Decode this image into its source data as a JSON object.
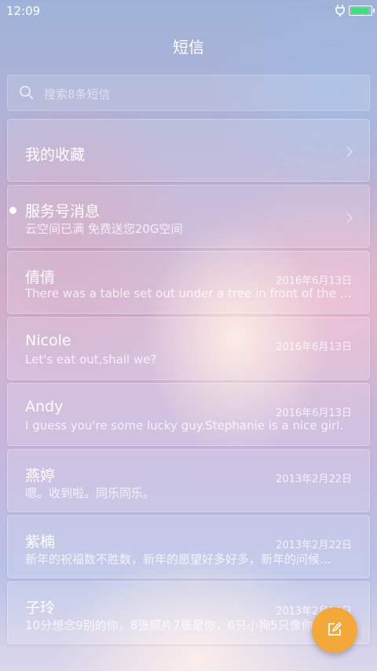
{
  "status_bar": {
    "time": "12:09",
    "battery_level": 0.95
  },
  "header": {
    "title": "短信"
  },
  "search": {
    "placeholder": "搜索8条短信"
  },
  "pinned": [
    {
      "title": "我的收藏",
      "subtitle": "",
      "unread": false
    },
    {
      "title": "服务号消息",
      "subtitle": "云空间已满 免费送您20G空间",
      "unread": true
    }
  ],
  "conversations": [
    {
      "name": "倩倩",
      "date": "2016年6月13日",
      "preview": "There was a table set out under a tree in front of the ho..."
    },
    {
      "name": "Nicole",
      "date": "2016年6月13日",
      "preview": "Let's eat out,shall we?"
    },
    {
      "name": "Andy",
      "date": "2016年6月13日",
      "preview": "I guess you're some lucky guy.Stephanie is a nice girl."
    },
    {
      "name": "燕婷",
      "date": "2013年2月22日",
      "preview": "嗯。收到啦。同乐同乐。"
    },
    {
      "name": "紫楠",
      "date": "2013年2月22日",
      "preview": "新年的祝福数不胜数，新年的愿望好多好多，新年的问候..."
    },
    {
      "name": "子玲",
      "date": "2013年2月22日",
      "preview": "10分想念9别的你，8张照片7张是你，6只小狗5只像你..."
    }
  ],
  "colors": {
    "accent_fab": "#f5a83a",
    "battery_fill": "#3fe07a"
  },
  "icons": {
    "search": "search-icon",
    "chevron": "chevron-right-icon",
    "compose": "compose-icon",
    "plug": "plug-icon",
    "battery": "battery-icon"
  }
}
